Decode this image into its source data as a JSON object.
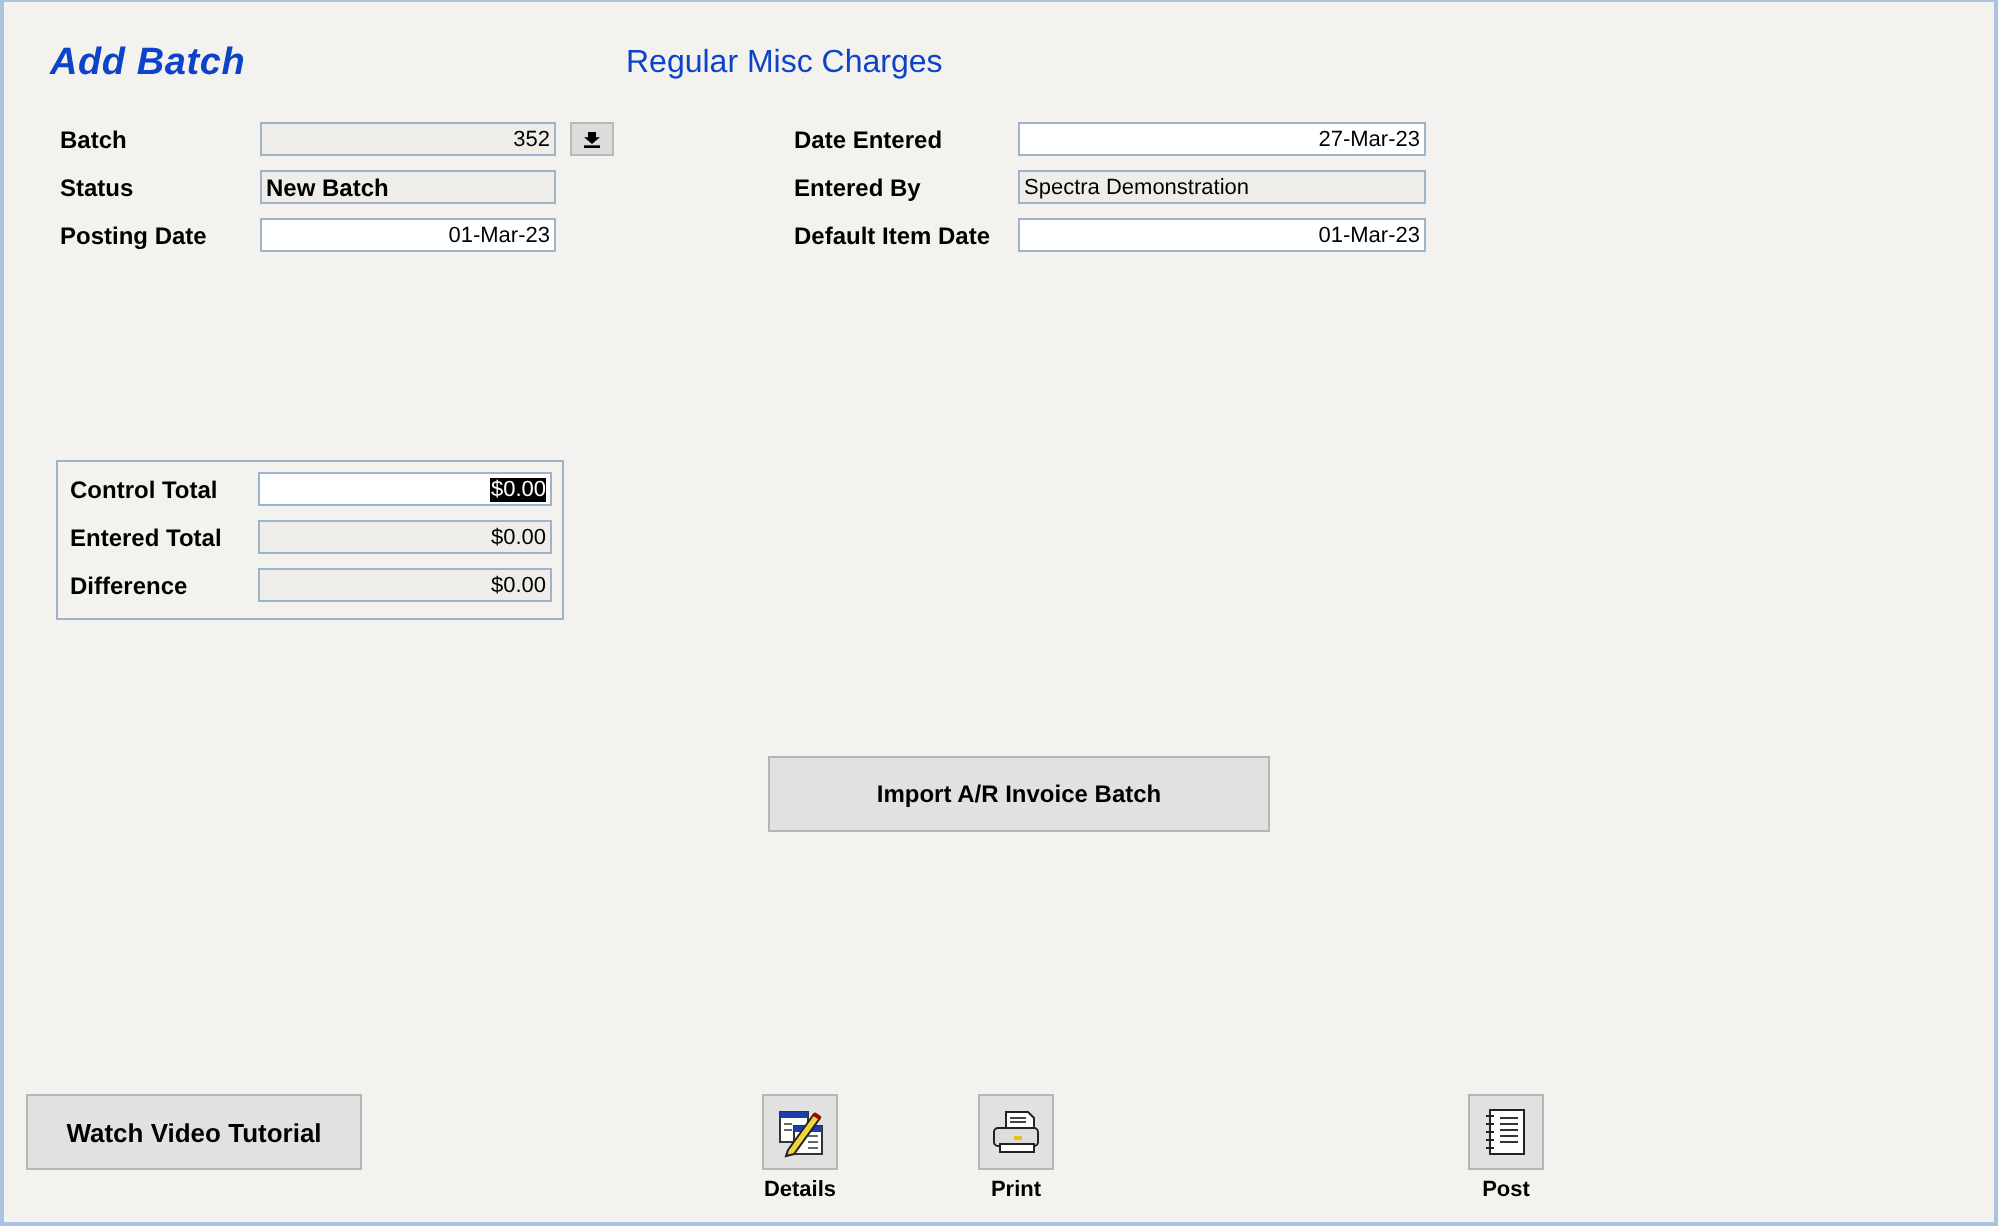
{
  "title": "Add Batch",
  "subtitle": "Regular Misc Charges",
  "left_fields": [
    {
      "label": "Batch",
      "value": "352",
      "kind": "number",
      "readonly": true,
      "lookup": true
    },
    {
      "label": "Status",
      "value": "New Batch",
      "kind": "text",
      "readonly": true,
      "bold": true
    },
    {
      "label": "Posting Date",
      "value": "01-Mar-23",
      "kind": "date",
      "readonly": false
    }
  ],
  "right_fields": [
    {
      "label": "Date Entered",
      "value": "27-Mar-23",
      "kind": "date",
      "readonly": false
    },
    {
      "label": "Entered By",
      "value": "Spectra Demonstration",
      "kind": "text",
      "readonly": true
    },
    {
      "label": "Default Item Date",
      "value": "01-Mar-23",
      "kind": "date",
      "readonly": false
    }
  ],
  "totals": [
    {
      "label": "Control Total",
      "value": "$0.00",
      "kind": "money",
      "readonly": false,
      "text_selected": true
    },
    {
      "label": "Entered Total",
      "value": "$0.00",
      "kind": "money",
      "readonly": true,
      "text_selected": false
    },
    {
      "label": "Difference",
      "value": "$0.00",
      "kind": "money",
      "readonly": true,
      "text_selected": false
    }
  ],
  "import_button": "Import A/R Invoice Batch",
  "video_button": "Watch Video Tutorial",
  "actions": [
    {
      "label": "Details",
      "kind": "details"
    },
    {
      "label": "Print",
      "kind": "print"
    },
    {
      "label": "Post",
      "kind": "post"
    }
  ]
}
